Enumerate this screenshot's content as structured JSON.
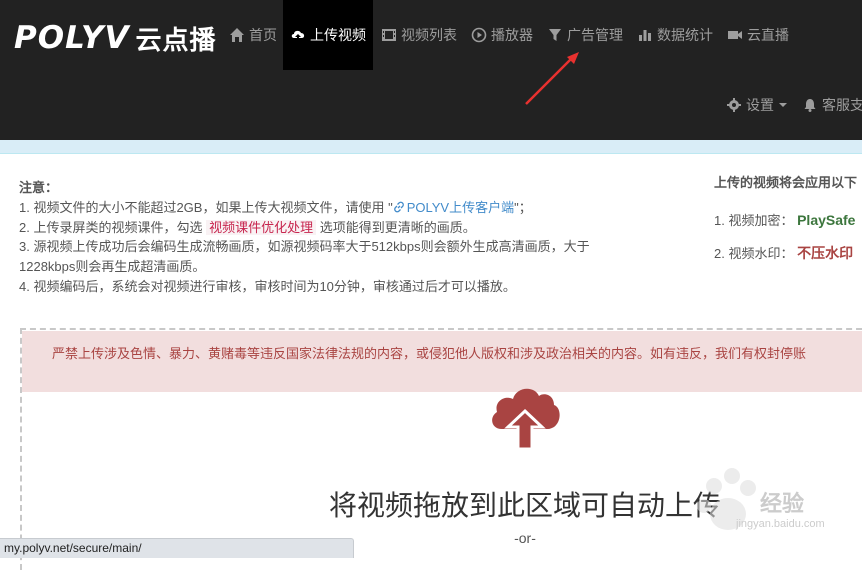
{
  "navbar": {
    "logo_en": "POLYV",
    "logo_cn": "云点播",
    "items": [
      {
        "label": "首页",
        "icon": "home-icon"
      },
      {
        "label": "上传视频",
        "icon": "cloud-upload-icon",
        "active": true
      },
      {
        "label": "视频列表",
        "icon": "film-icon"
      },
      {
        "label": "播放器",
        "icon": "play-circle-icon"
      },
      {
        "label": "广告管理",
        "icon": "filter-icon"
      },
      {
        "label": "数据统计",
        "icon": "bar-chart-icon"
      },
      {
        "label": "云直播",
        "icon": "video-camera-icon"
      }
    ],
    "settings_label": "设置",
    "support_label": "客服支"
  },
  "notes": {
    "title": "注意：",
    "line1_prefix": "1. 视频文件的大小不能超过2GB，如果上传大视频文件，请使用 \"",
    "line1_link": "POLYV上传客户端",
    "line1_suffix": "\"；",
    "line2_prefix": "2. 上传录屏类的视频课件，勾选",
    "line2_highlight": "视频课件优化处理",
    "line2_suffix": "选项能得到更清晰的画质。",
    "line3a": "3. 源视频上传成功后会编码生成流畅画质，如源视频码率大于512kbps则会额外生成高清画质，大于",
    "line3b": "1228kbps则会再生成超清画质。",
    "line4": "4. 视频编码后，系统会对视频进行审核，审核时间为10分钟，审核通过后才可以播放。"
  },
  "right_info": {
    "title": "上传的视频将会应用以下",
    "enc_label": "1. 视频加密：",
    "enc_value": "PlaySafe",
    "wm_label": "2. 视频水印：",
    "wm_value": "不压水印"
  },
  "dropzone": {
    "warning": "严禁上传涉及色情、暴力、黄赌毒等违反国家法律法规的内容，或侵犯他人版权和涉及政治相关的内容。如有违反，我们有权封停账",
    "drop_text": "将视频拖放到此区域可自动上传",
    "or_text": "-or-"
  },
  "statusbar": {
    "url": "my.polyv.net/secure/main/"
  },
  "watermark": {
    "text": "经验",
    "sub": "jingyan.baidu.com"
  },
  "colors": {
    "navbar_bg": "#222222",
    "active_bg": "#000000",
    "warning_bg": "#f2dede",
    "upload_icon": "#a94442",
    "arrow": "#e8312f"
  }
}
